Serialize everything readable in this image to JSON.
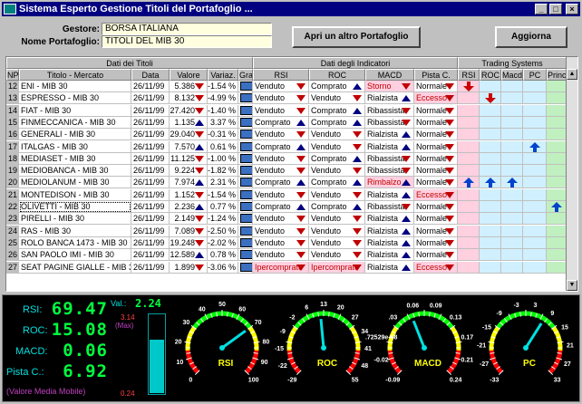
{
  "window": {
    "title": "Sistema Esperto Gestione Titoli del Portafoglio ...",
    "minimize": "_",
    "maximize": "□",
    "close": "×"
  },
  "form": {
    "gestore_label": "Gestore:",
    "gestore_value": "BORSA ITALIANA",
    "portfolio_label": "Nome Portafoglio:",
    "portfolio_value": "TITOLI DEL MIB 30",
    "open_button": "Apri un altro Portafoglio",
    "update_button": "Aggiorna"
  },
  "grid": {
    "group_headers": {
      "titoli": "Dati dei Titoli",
      "indicatori": "Dati degli Indicatori",
      "trading": "Trading Systems"
    },
    "columns": {
      "np": "NP",
      "titolo": "Titolo - Mercato",
      "data": "Data",
      "valore": "Valore",
      "variaz": "Variaz.",
      "graf": "Graf",
      "rsi": "RSI",
      "roc": "ROC",
      "macd": "MACD",
      "pista": "Pista C.",
      "ts_rsi": "RSI",
      "ts_roc": "ROC",
      "ts_macd": "Macd",
      "ts_pc": "PC",
      "ts_princ": "Princ."
    },
    "rows": [
      {
        "np": "12",
        "titolo": "ENI - MIB 30",
        "data": "26/11/99",
        "valore": "5.386",
        "dir": "down",
        "variaz": "-1.54 %",
        "rsi": "Venduto",
        "rsi_d": "down",
        "roc": "Comprato",
        "roc_d": "up",
        "macd": "Storno",
        "macd_d": "down",
        "pista": "Normale",
        "pista_d": "down",
        "ts": {
          "rsi": "down"
        }
      },
      {
        "np": "13",
        "titolo": "ESPRESSO - MIB 30",
        "data": "26/11/99",
        "valore": "8.132",
        "dir": "down",
        "variaz": "-4.99 %",
        "rsi": "Venduto",
        "rsi_d": "down",
        "roc": "Venduto",
        "roc_d": "down",
        "macd": "Rialzista",
        "macd_d": "up",
        "pista": "Eccesso",
        "pista_d": "down",
        "ts": {
          "roc": "down"
        }
      },
      {
        "np": "14",
        "titolo": "FIAT - MIB 30",
        "data": "26/11/99",
        "valore": "27.420",
        "dir": "down",
        "variaz": "-1.40 %",
        "rsi": "Venduto",
        "rsi_d": "down",
        "roc": "Comprato",
        "roc_d": "up",
        "macd": "Ribassista",
        "macd_d": "down",
        "pista": "Normale",
        "pista_d": "down",
        "ts": {}
      },
      {
        "np": "15",
        "titolo": "FINMECCANICA - MIB 30",
        "data": "26/11/99",
        "valore": "1.135",
        "dir": "up",
        "variaz": "3.37 %",
        "rsi": "Comprato",
        "rsi_d": "up",
        "roc": "Comprato",
        "roc_d": "up",
        "macd": "Ribassista",
        "macd_d": "down",
        "pista": "Normale",
        "pista_d": "down",
        "ts": {}
      },
      {
        "np": "16",
        "titolo": "GENERALI - MIB 30",
        "data": "26/11/99",
        "valore": "29.040",
        "dir": "down",
        "variaz": "-0.31 %",
        "rsi": "Venduto",
        "rsi_d": "down",
        "roc": "Venduto",
        "roc_d": "down",
        "macd": "Rialzista",
        "macd_d": "up",
        "pista": "Normale",
        "pista_d": "down",
        "ts": {}
      },
      {
        "np": "17",
        "titolo": "ITALGAS - MIB 30",
        "data": "26/11/99",
        "valore": "7.570",
        "dir": "up",
        "variaz": "0.61 %",
        "rsi": "Comprato",
        "rsi_d": "up",
        "roc": "Venduto",
        "roc_d": "down",
        "macd": "Rialzista",
        "macd_d": "up",
        "pista": "Normale",
        "pista_d": "down",
        "ts": {
          "pc": "up"
        }
      },
      {
        "np": "18",
        "titolo": "MEDIASET - MIB 30",
        "data": "26/11/99",
        "valore": "11.125",
        "dir": "down",
        "variaz": "-1.00 %",
        "rsi": "Venduto",
        "rsi_d": "down",
        "roc": "Comprato",
        "roc_d": "up",
        "macd": "Ribassista",
        "macd_d": "down",
        "pista": "Normale",
        "pista_d": "down",
        "ts": {}
      },
      {
        "np": "19",
        "titolo": "MEDIOBANCA - MIB 30",
        "data": "26/11/99",
        "valore": "9.224",
        "dir": "down",
        "variaz": "-1.82 %",
        "rsi": "Venduto",
        "rsi_d": "down",
        "roc": "Venduto",
        "roc_d": "down",
        "macd": "Ribassista",
        "macd_d": "down",
        "pista": "Normale",
        "pista_d": "down",
        "ts": {}
      },
      {
        "np": "20",
        "titolo": "MEDIOLANUM - MIB 30",
        "data": "26/11/99",
        "valore": "7.974",
        "dir": "up",
        "variaz": "2.31 %",
        "rsi": "Comprato",
        "rsi_d": "up",
        "roc": "Comprato",
        "roc_d": "up",
        "macd": "Rimbalzo",
        "macd_d": "up",
        "pista": "Normale",
        "pista_d": "down",
        "ts": {
          "rsi": "up",
          "roc": "up",
          "macd": "up"
        }
      },
      {
        "np": "21",
        "titolo": "MONTEDISON - MIB 30",
        "data": "26/11/99",
        "valore": "1.152",
        "dir": "down",
        "variaz": "-1.54 %",
        "rsi": "Venduto",
        "rsi_d": "down",
        "roc": "Venduto",
        "roc_d": "down",
        "macd": "Rialzista",
        "macd_d": "up",
        "pista": "Eccesso",
        "pista_d": "down",
        "ts": {}
      },
      {
        "np": "22",
        "titolo": "OLIVETTI - MIB 30",
        "data": "26/11/99",
        "valore": "2.236",
        "dir": "up",
        "variaz": "0.77 %",
        "rsi": "Comprato",
        "rsi_d": "up",
        "roc": "Comprato",
        "roc_d": "up",
        "macd": "Ribassista",
        "macd_d": "down",
        "pista": "Normale",
        "pista_d": "down",
        "ts": {
          "princ": "up"
        },
        "selected": true
      },
      {
        "np": "23",
        "titolo": "PIRELLI - MIB 30",
        "data": "26/11/99",
        "valore": "2.149",
        "dir": "down",
        "variaz": "-1.24 %",
        "rsi": "Venduto",
        "rsi_d": "down",
        "roc": "Venduto",
        "roc_d": "down",
        "macd": "Rialzista",
        "macd_d": "up",
        "pista": "Normale",
        "pista_d": "down",
        "ts": {}
      },
      {
        "np": "24",
        "titolo": "RAS - MIB 30",
        "data": "26/11/99",
        "valore": "7.089",
        "dir": "down",
        "variaz": "-2.50 %",
        "rsi": "Venduto",
        "rsi_d": "down",
        "roc": "Venduto",
        "roc_d": "down",
        "macd": "Rialzista",
        "macd_d": "up",
        "pista": "Normale",
        "pista_d": "down",
        "ts": {}
      },
      {
        "np": "25",
        "titolo": "ROLO BANCA 1473 - MIB 30",
        "data": "26/11/99",
        "valore": "19.248",
        "dir": "down",
        "variaz": "-2.02 %",
        "rsi": "Venduto",
        "rsi_d": "down",
        "roc": "Venduto",
        "roc_d": "down",
        "macd": "Rialzista",
        "macd_d": "up",
        "pista": "Normale",
        "pista_d": "down",
        "ts": {}
      },
      {
        "np": "26",
        "titolo": "SAN PAOLO IMI - MIB 30",
        "data": "26/11/99",
        "valore": "12.589",
        "dir": "up",
        "variaz": "0.78 %",
        "rsi": "Venduto",
        "rsi_d": "down",
        "roc": "Venduto",
        "roc_d": "down",
        "macd": "Rialzista",
        "macd_d": "up",
        "pista": "Normale",
        "pista_d": "down",
        "ts": {}
      },
      {
        "np": "27",
        "titolo": "SEAT PAGINE GIALLE - MIB 3",
        "data": "26/11/99",
        "valore": "1.899",
        "dir": "down",
        "variaz": "-3.06 %",
        "rsi": "Ipercomprato",
        "rsi_d": "down",
        "roc": "Ipercomprato",
        "roc_d": "down",
        "macd": "Rialzista",
        "macd_d": "up",
        "pista": "Eccesso",
        "pista_d": "down",
        "ts": {}
      }
    ]
  },
  "panel": {
    "rsi_label": "RSI:",
    "rsi_value": "69.47",
    "roc_label": "ROC:",
    "roc_value": "15.08",
    "macd_label": "MACD:",
    "macd_value": "0.06",
    "pc_label": "Pista C.:",
    "pc_value": "6.92",
    "caption": "(Valore Media Mobile)",
    "val_label": "Val.:",
    "val_value": "2.24",
    "max_value": "3.14",
    "max_label": "(Max)",
    "min_value": "0.24",
    "bar_fraction": 0.67
  },
  "gauges": [
    {
      "name": "RSI",
      "ticks": [
        "0",
        "10",
        "20",
        "30",
        "40",
        "50",
        "60",
        "70",
        "80",
        "90",
        "100"
      ],
      "needle": 0.7
    },
    {
      "name": "ROC",
      "ticks": [
        "-29",
        "-22",
        "-15",
        "-9",
        "-2",
        "6",
        "13",
        "20",
        "27",
        "34",
        "41",
        "48",
        "55"
      ],
      "needle": 0.48
    },
    {
      "name": "MACD",
      "ticks": [
        "-0.09",
        "-0.02",
        ".72529e-08",
        ".03",
        "0.06",
        "0.09",
        "0.13",
        "0.17",
        "0.21",
        "0.24"
      ],
      "needle": 0.42
    },
    {
      "name": "PC",
      "ticks": [
        "-33",
        "-27",
        "-21",
        "-15",
        "-9",
        "-3",
        "3",
        "9",
        "15",
        "21",
        "27",
        "33"
      ],
      "needle": 0.62
    }
  ],
  "colors": {
    "up_arrow": "#000080",
    "down_arrow": "#c00000",
    "green_digits": "#00ff40"
  }
}
